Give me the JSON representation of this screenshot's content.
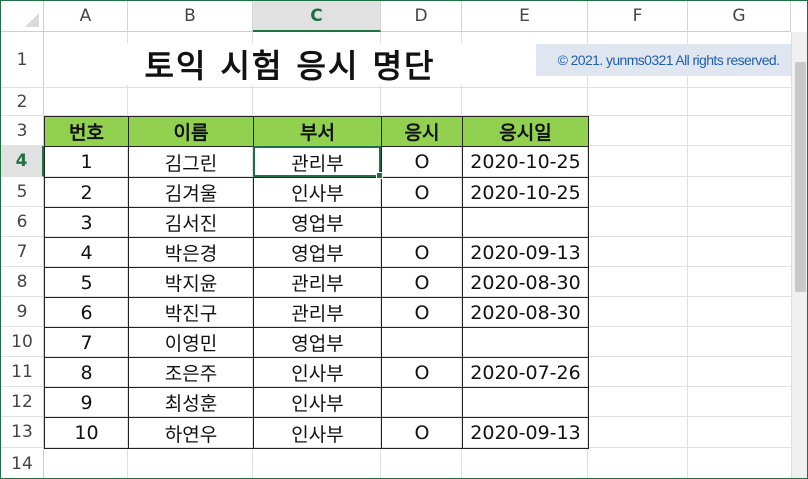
{
  "columns": [
    "A",
    "B",
    "C",
    "D",
    "E",
    "F",
    "G"
  ],
  "active_column": "C",
  "rows": [
    "1",
    "2",
    "3",
    "4",
    "5",
    "6",
    "7",
    "8",
    "9",
    "10",
    "11",
    "12",
    "13",
    "14"
  ],
  "active_row": "4",
  "title": "토익 시험 응시 명단",
  "copyright": "© 2021. yunms0321 All rights reserved.",
  "table": {
    "headers": [
      "번호",
      "이름",
      "부서",
      "응시",
      "응시일"
    ],
    "rows": [
      [
        "1",
        "김그린",
        "관리부",
        "O",
        "2020-10-25"
      ],
      [
        "2",
        "김겨울",
        "인사부",
        "O",
        "2020-10-25"
      ],
      [
        "3",
        "김서진",
        "영업부",
        "",
        ""
      ],
      [
        "4",
        "박은경",
        "영업부",
        "O",
        "2020-09-13"
      ],
      [
        "5",
        "박지윤",
        "관리부",
        "O",
        "2020-08-30"
      ],
      [
        "6",
        "박진구",
        "관리부",
        "O",
        "2020-08-30"
      ],
      [
        "7",
        "이영민",
        "영업부",
        "",
        ""
      ],
      [
        "8",
        "조은주",
        "인사부",
        "O",
        "2020-07-26"
      ],
      [
        "9",
        "최성훈",
        "인사부",
        "",
        ""
      ],
      [
        "10",
        "하연우",
        "인사부",
        "O",
        "2020-09-13"
      ]
    ]
  },
  "colors": {
    "header_fill": "#92d050",
    "accent": "#1e7145",
    "copyright_fill": "#dfe6ef",
    "copyright_text": "#1f5fb0"
  }
}
